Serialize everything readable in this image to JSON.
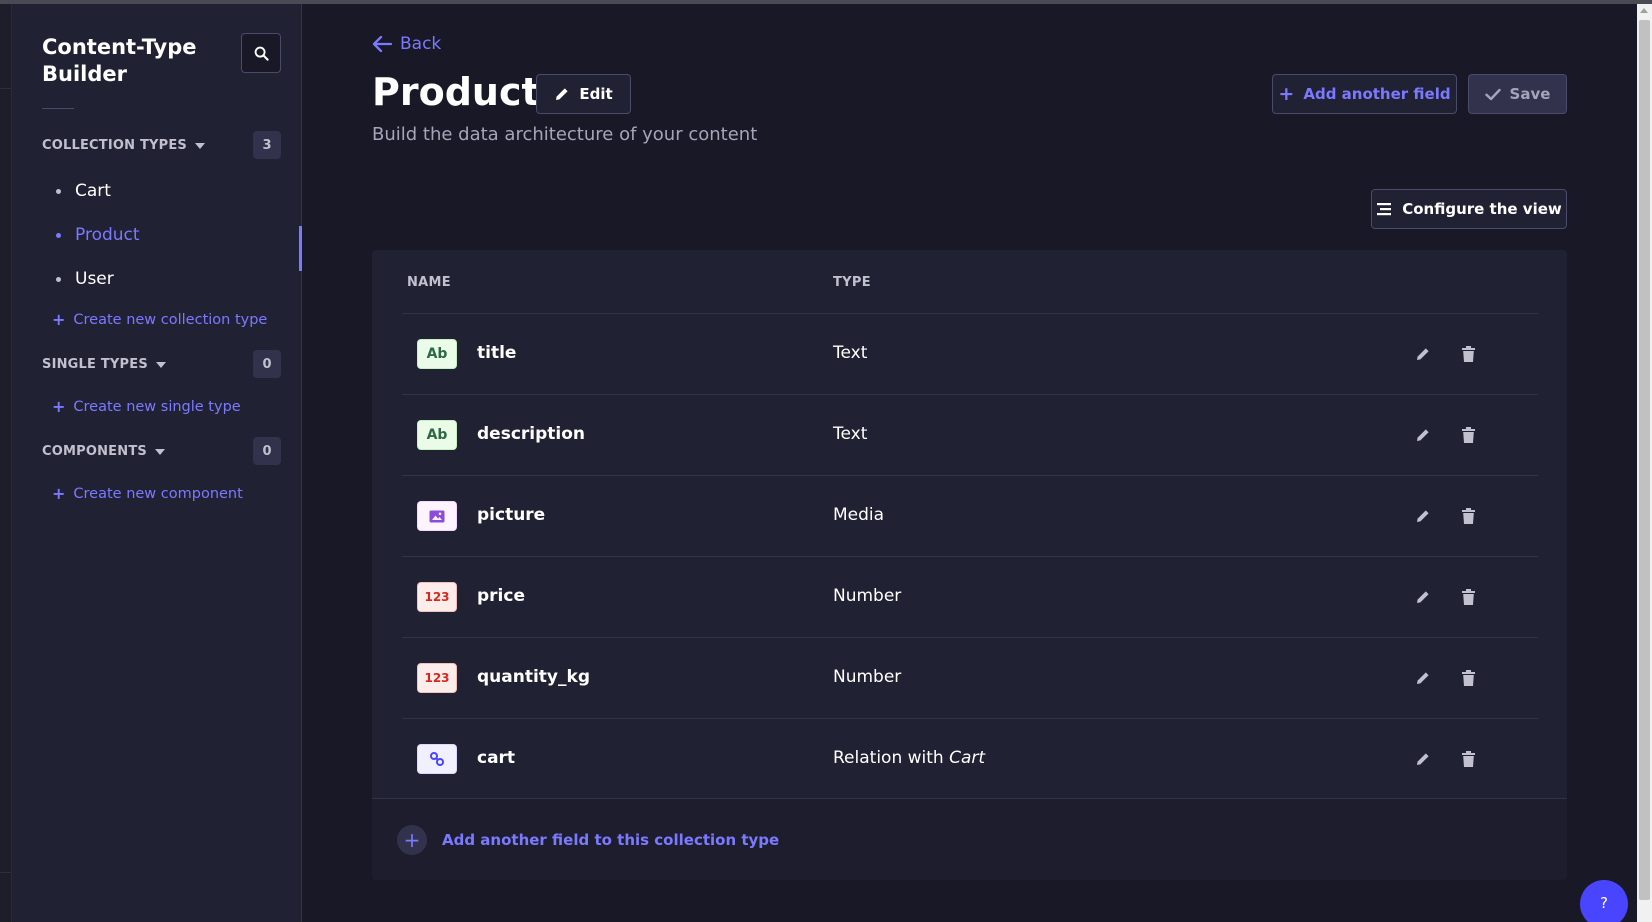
{
  "sidebar": {
    "title": "Content-Type Builder",
    "collection_types": {
      "label": "COLLECTION TYPES",
      "count": "3",
      "items": [
        {
          "label": "Cart"
        },
        {
          "label": "Product"
        },
        {
          "label": "User"
        }
      ],
      "create_label": "Create new collection type"
    },
    "single_types": {
      "label": "SINGLE TYPES",
      "count": "0",
      "create_label": "Create new single type"
    },
    "components": {
      "label": "COMPONENTS",
      "count": "0",
      "create_label": "Create new component"
    }
  },
  "header": {
    "back_label": "Back",
    "title": "Product",
    "edit_label": "Edit",
    "subtitle": "Build the data architecture of your content",
    "add_field_label": "Add another field",
    "save_label": "Save",
    "configure_label": "Configure the view"
  },
  "table": {
    "columns": {
      "name": "NAME",
      "type": "TYPE"
    },
    "rows": [
      {
        "icon": "Ab",
        "icon_kind": "text",
        "name": "title",
        "type": "Text"
      },
      {
        "icon": "Ab",
        "icon_kind": "text",
        "name": "description",
        "type": "Text"
      },
      {
        "icon": "media-icon",
        "icon_kind": "media",
        "name": "picture",
        "type": "Media"
      },
      {
        "icon": "123",
        "icon_kind": "number",
        "name": "price",
        "type": "Number"
      },
      {
        "icon": "123",
        "icon_kind": "number",
        "name": "quantity_kg",
        "type": "Number"
      },
      {
        "icon": "link-icon",
        "icon_kind": "relation",
        "name": "cart",
        "type": "Relation with",
        "relation_target": "Cart"
      }
    ],
    "footer_add_label": "Add another field to this collection type"
  },
  "help": {
    "label": "?"
  },
  "colors": {
    "background": "#181826",
    "sidebar": "#212134",
    "accent": "#7b79ff",
    "primary": "#4945ff"
  }
}
